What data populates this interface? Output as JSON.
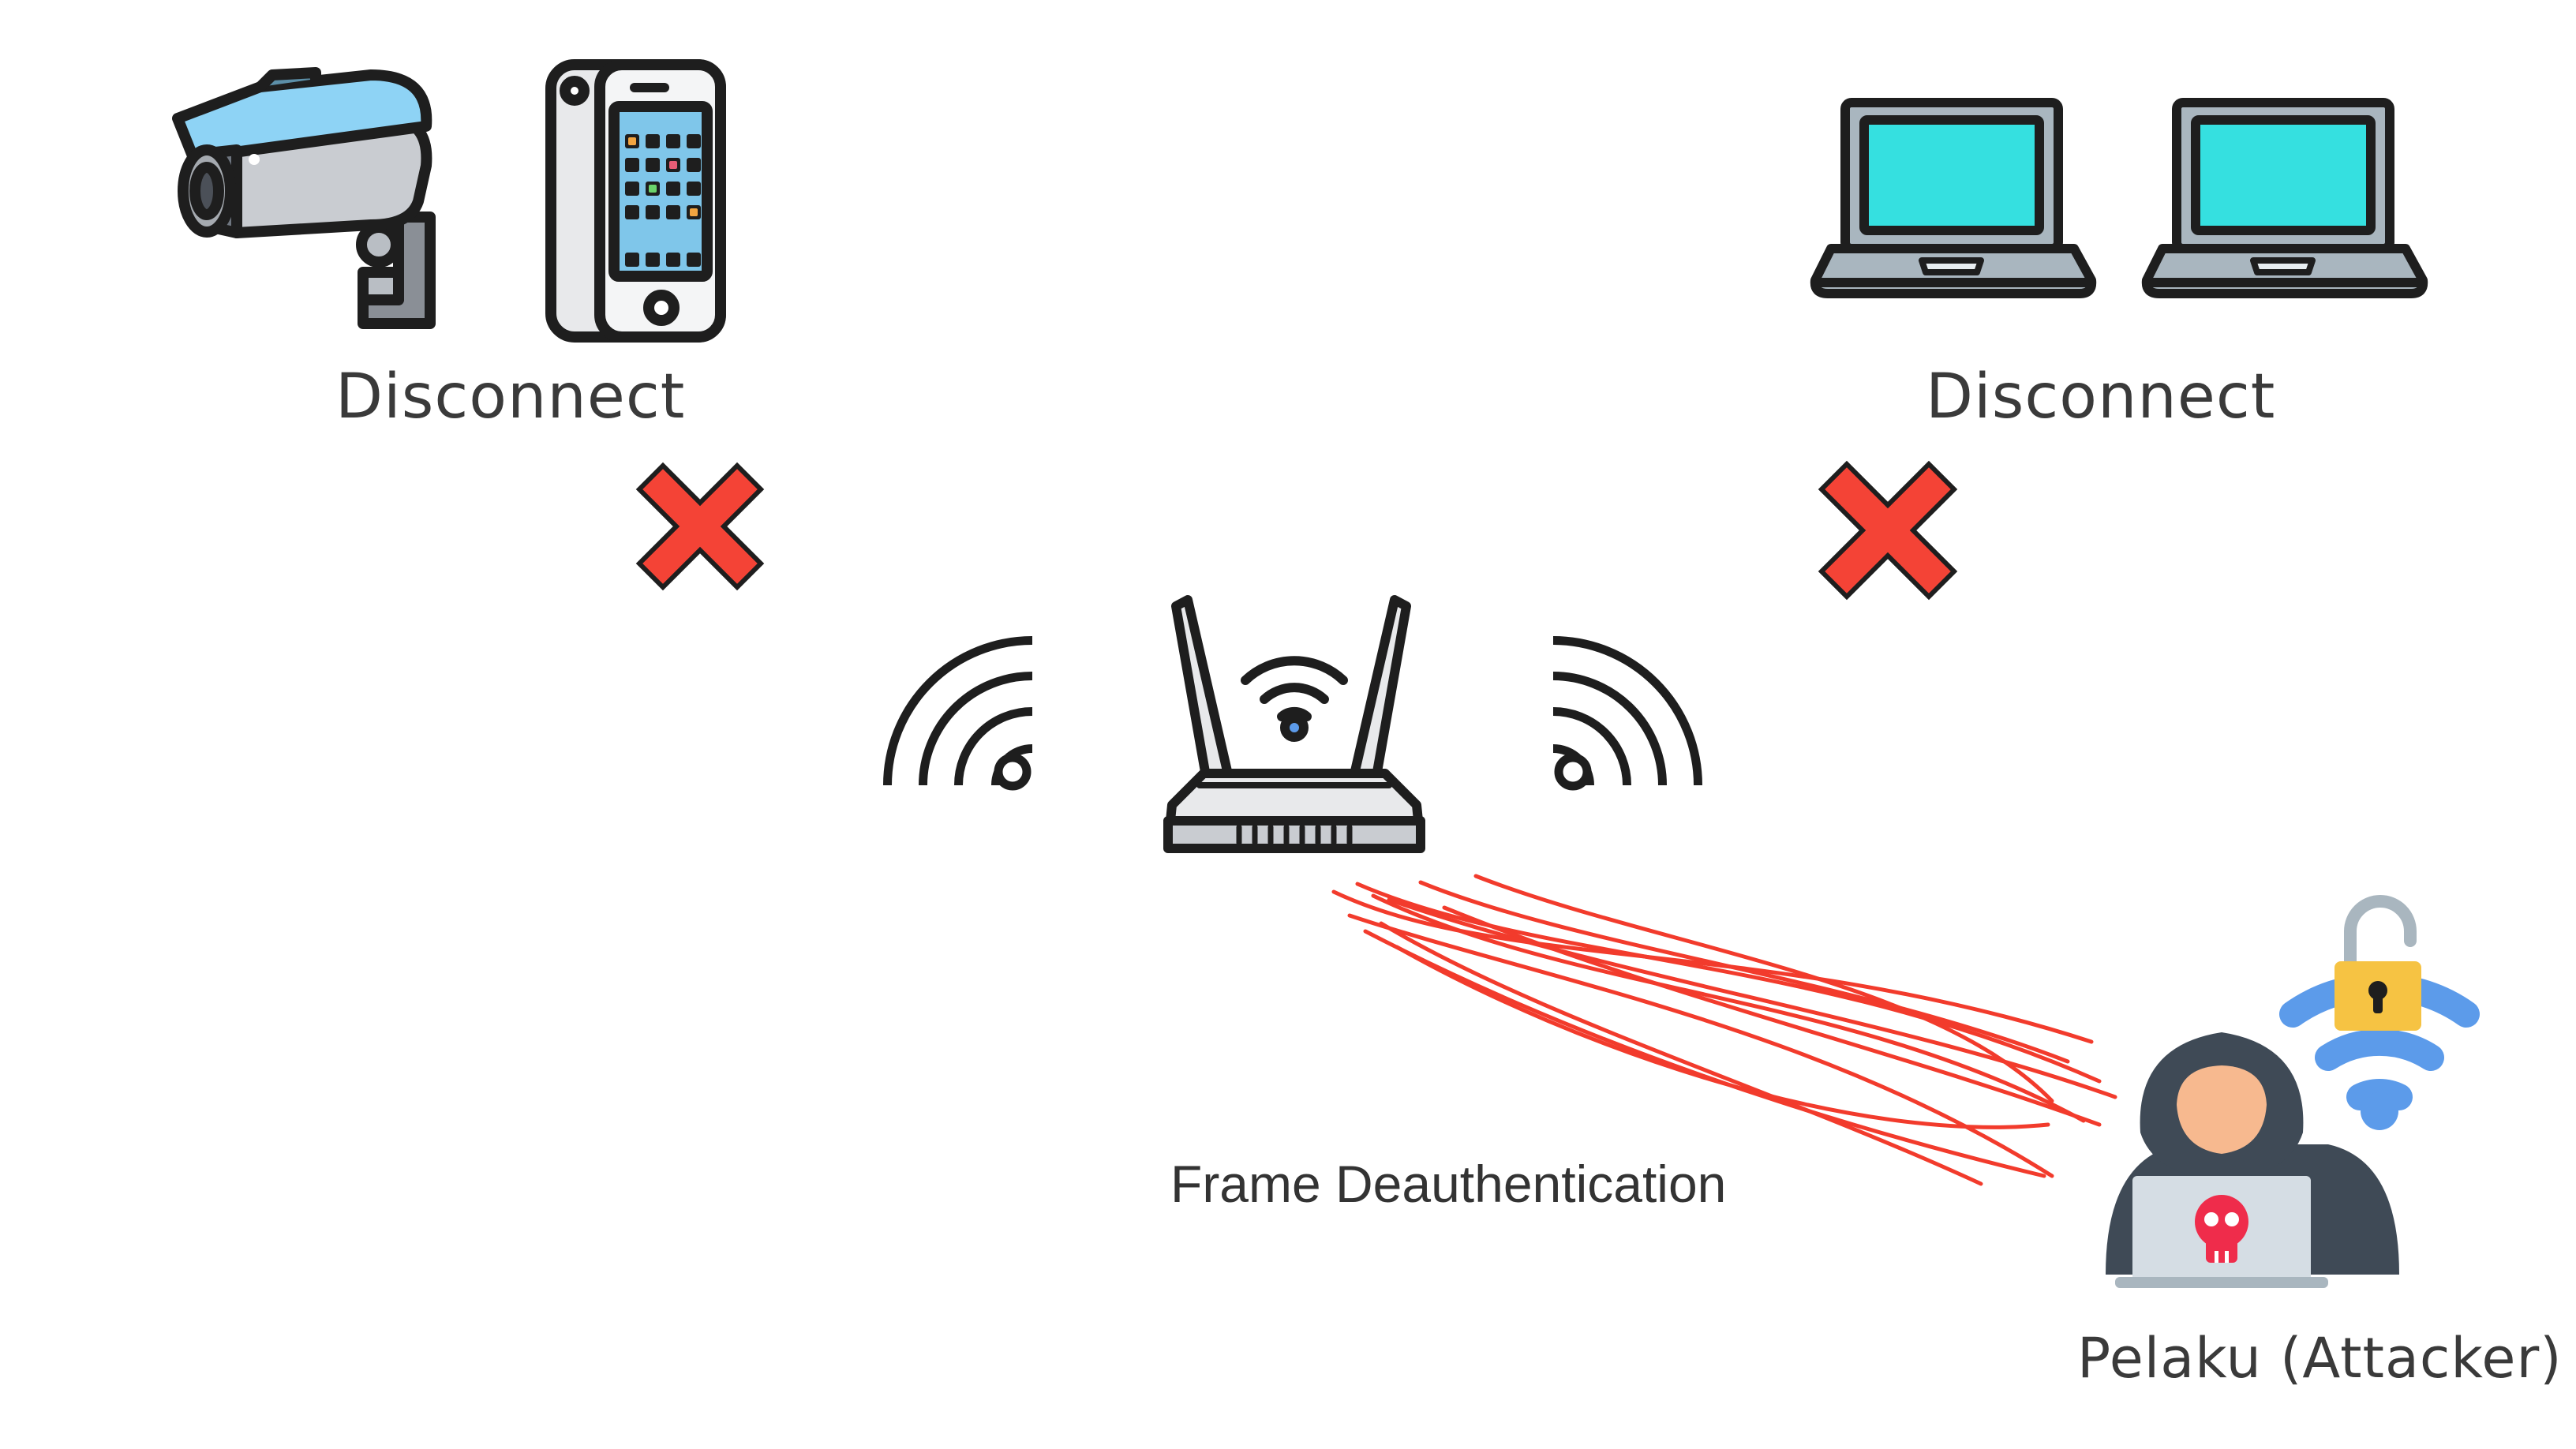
{
  "labels": {
    "disconnect_left": "Disconnect",
    "disconnect_right": "Disconnect",
    "frame_deauth": "Frame Deauthentication",
    "attacker": "Pelaku (Attacker)"
  },
  "icons": {
    "camera": "cctv-camera-icon",
    "phone": "smartphone-icon",
    "laptop_1": "laptop-icon",
    "laptop_2": "laptop-icon",
    "cross_left": "red-x-icon",
    "cross_right": "red-x-icon",
    "router": "wifi-router-icon",
    "wifi_left": "wifi-signal-icon",
    "wifi_right": "wifi-signal-icon",
    "hacker": "hacker-icon",
    "wifi_lock": "unlocked-wifi-icon"
  },
  "colors": {
    "cross": "#f44336",
    "attack_lines": "#f23b2c",
    "laptop_screen": "#35e0e0",
    "camera_hood": "#8ed3f5",
    "phone_screen": "#7fc6ea",
    "wifi_lock": "#5c9bea",
    "padlock": "#f6c343",
    "skull": "#ef2c4b",
    "hacker_face": "#f7b98f",
    "hood": "#3f4a56",
    "outline": "#1e1e1e"
  }
}
